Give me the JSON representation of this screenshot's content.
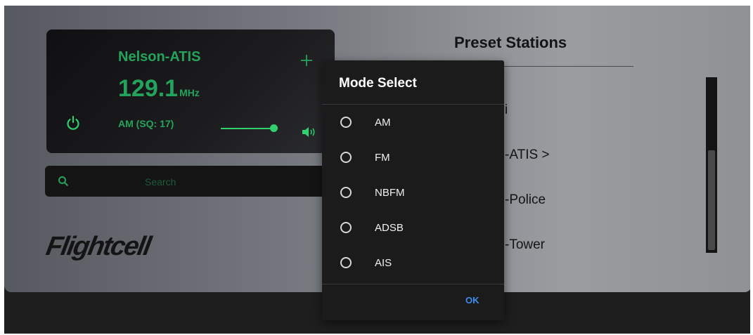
{
  "radio": {
    "station_name": "Nelson-ATIS",
    "frequency": "129.1",
    "frequency_unit": "MHz",
    "mode_status": "AM (SQ: 17)",
    "volume_level": 0.95
  },
  "search": {
    "placeholder": "Search"
  },
  "logo": {
    "text": "Flightcell"
  },
  "presets": {
    "title": "Preset Stations",
    "items": [
      "i",
      "-ATIS >",
      "-Police",
      "-Tower"
    ]
  },
  "dialog": {
    "title": "Mode Select",
    "options": [
      "AM",
      "FM",
      "NBFM",
      "ADSB",
      "AIS"
    ],
    "ok_label": "OK"
  },
  "colors": {
    "accent_green": "#23a35b",
    "ok_blue": "#3d8ef0"
  }
}
